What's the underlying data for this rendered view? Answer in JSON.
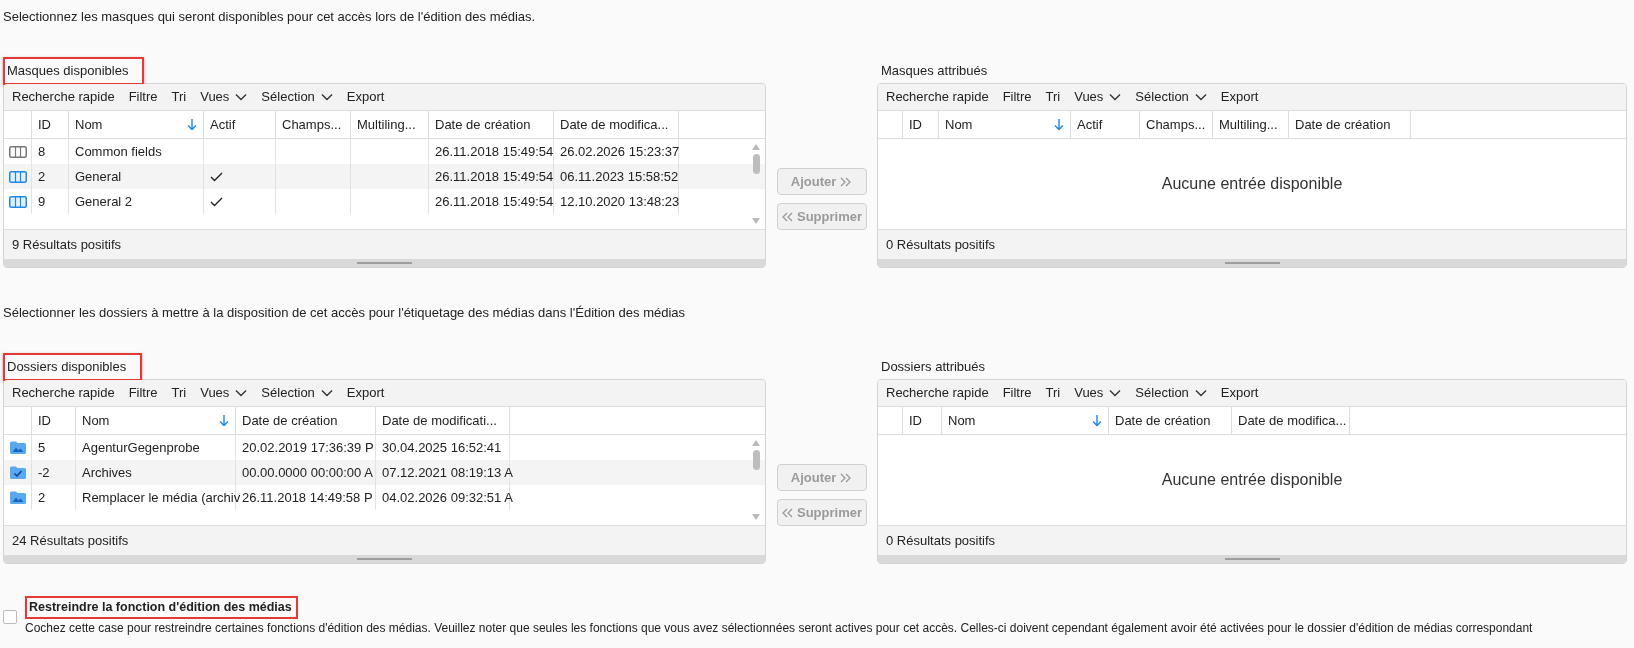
{
  "sections": [
    {
      "intro": "Selectionnez les masques qui seront disponibles pour cet accès lors de l'édition des médias.",
      "available": {
        "label": "Masques disponibles",
        "highlighted": true,
        "toolbar": [
          {
            "label": "Recherche rapide",
            "dropdown": false
          },
          {
            "label": "Filtre",
            "dropdown": false
          },
          {
            "label": "Tri",
            "dropdown": false
          },
          {
            "label": "Vues",
            "dropdown": true
          },
          {
            "label": "Sélection",
            "dropdown": true
          },
          {
            "label": "Export",
            "dropdown": false
          }
        ],
        "columns": [
          {
            "label": "ID",
            "kind": "text",
            "sorted": false
          },
          {
            "label": "Nom",
            "kind": "text",
            "sorted": true
          },
          {
            "label": "Actif",
            "kind": "check",
            "sorted": false
          },
          {
            "label": "Champs...",
            "kind": "empty",
            "sorted": false
          },
          {
            "label": "Multiling...",
            "kind": "empty",
            "sorted": false
          },
          {
            "label": "Date de création",
            "kind": "text",
            "sorted": false
          },
          {
            "label": "Date de modifica...",
            "kind": "text",
            "sorted": false
          }
        ],
        "rows": [
          {
            "kind": "mask",
            "active": false,
            "cells": [
              "8",
              "Common fields",
              "26.11.2018 15:49:54",
              "26.02.2026 15:23:37"
            ]
          },
          {
            "kind": "mask",
            "active": true,
            "cells": [
              "2",
              "General",
              "26.11.2018 15:49:54",
              "06.11.2023 15:58:52"
            ]
          },
          {
            "kind": "mask",
            "active": true,
            "cells": [
              "9",
              "General 2",
              "26.11.2018 15:49:54",
              "12.10.2020 13:48:23"
            ]
          }
        ],
        "footer": "9 Résultats positifs"
      },
      "buttons": [
        {
          "label": "Ajouter",
          "kind": "add",
          "disabled": true
        },
        {
          "label": "Supprimer",
          "kind": "remove",
          "disabled": true
        }
      ],
      "assigned": {
        "label": "Masques attribués",
        "highlighted": false,
        "toolbar": [
          {
            "label": "Recherche rapide",
            "dropdown": false
          },
          {
            "label": "Filtre",
            "dropdown": false
          },
          {
            "label": "Tri",
            "dropdown": false
          },
          {
            "label": "Vues",
            "dropdown": true
          },
          {
            "label": "Sélection",
            "dropdown": true
          },
          {
            "label": "Export",
            "dropdown": false
          }
        ],
        "columns": [
          {
            "label": "ID",
            "sorted": false
          },
          {
            "label": "Nom",
            "sorted": true
          },
          {
            "label": "Actif",
            "sorted": false
          },
          {
            "label": "Champs...",
            "sorted": false
          },
          {
            "label": "Multiling...",
            "sorted": false
          },
          {
            "label": "Date de création",
            "sorted": false
          }
        ],
        "empty_text": "Aucune entrée disponible",
        "footer": "0 Résultats positifs"
      }
    },
    {
      "intro": "Sélectionner les dossiers à mettre à la disposition de cet accès pour l'étiquetage des médias dans l'Édition des médias",
      "available": {
        "label": "Dossiers disponibles",
        "highlighted": true,
        "toolbar": [
          {
            "label": "Recherche rapide",
            "dropdown": false
          },
          {
            "label": "Filtre",
            "dropdown": false
          },
          {
            "label": "Tri",
            "dropdown": false
          },
          {
            "label": "Vues",
            "dropdown": true
          },
          {
            "label": "Sélection",
            "dropdown": true
          },
          {
            "label": "Export",
            "dropdown": false
          }
        ],
        "columns": [
          {
            "label": "ID",
            "kind": "text",
            "sorted": false
          },
          {
            "label": "Nom",
            "kind": "text",
            "sorted": true
          },
          {
            "label": "Date de création",
            "kind": "text",
            "sorted": false
          },
          {
            "label": "Date de modificati...",
            "kind": "text",
            "sorted": false
          }
        ],
        "rows": [
          {
            "kind": "image-folder",
            "cells": [
              "5",
              "AgenturGegenprobe",
              "20.02.2019 17:36:39 P",
              "30.04.2025 16:52:41"
            ]
          },
          {
            "kind": "check-folder",
            "cells": [
              "-2",
              "Archives",
              "00.00.0000 00:00:00 A",
              "07.12.2021 08:19:13 A"
            ]
          },
          {
            "kind": "image-folder",
            "cells": [
              "2",
              "Remplacer le média (archiv",
              "26.11.2018 14:49:58 P",
              "04.02.2026 09:32:51 A"
            ]
          }
        ],
        "footer": "24 Résultats positifs"
      },
      "buttons": [
        {
          "label": "Ajouter",
          "kind": "add",
          "disabled": true
        },
        {
          "label": "Supprimer",
          "kind": "remove",
          "disabled": true
        }
      ],
      "assigned": {
        "label": "Dossiers attribués",
        "highlighted": false,
        "toolbar": [
          {
            "label": "Recherche rapide",
            "dropdown": false
          },
          {
            "label": "Filtre",
            "dropdown": false
          },
          {
            "label": "Tri",
            "dropdown": false
          },
          {
            "label": "Vues",
            "dropdown": true
          },
          {
            "label": "Sélection",
            "dropdown": true
          },
          {
            "label": "Export",
            "dropdown": false
          }
        ],
        "columns": [
          {
            "label": "ID",
            "sorted": false
          },
          {
            "label": "Nom",
            "sorted": true
          },
          {
            "label": "Date de création",
            "sorted": false
          },
          {
            "label": "Date de modifica...",
            "sorted": false
          }
        ],
        "empty_text": "Aucune entrée disponible",
        "footer": "0 Résultats positifs"
      }
    }
  ],
  "restrict": {
    "label": "Restreindre la fonction d'édition des médias",
    "highlighted": true,
    "checked": false,
    "description": "Cochez cette case pour restreindre certaines fonctions d'édition des médias. Veuillez noter que seules les fonctions que vous avez sélectionnées seront actives pour cet accès. Celles-ci doivent cependant également avoir été activées pour le dossier d'édition de médias correspondant"
  }
}
